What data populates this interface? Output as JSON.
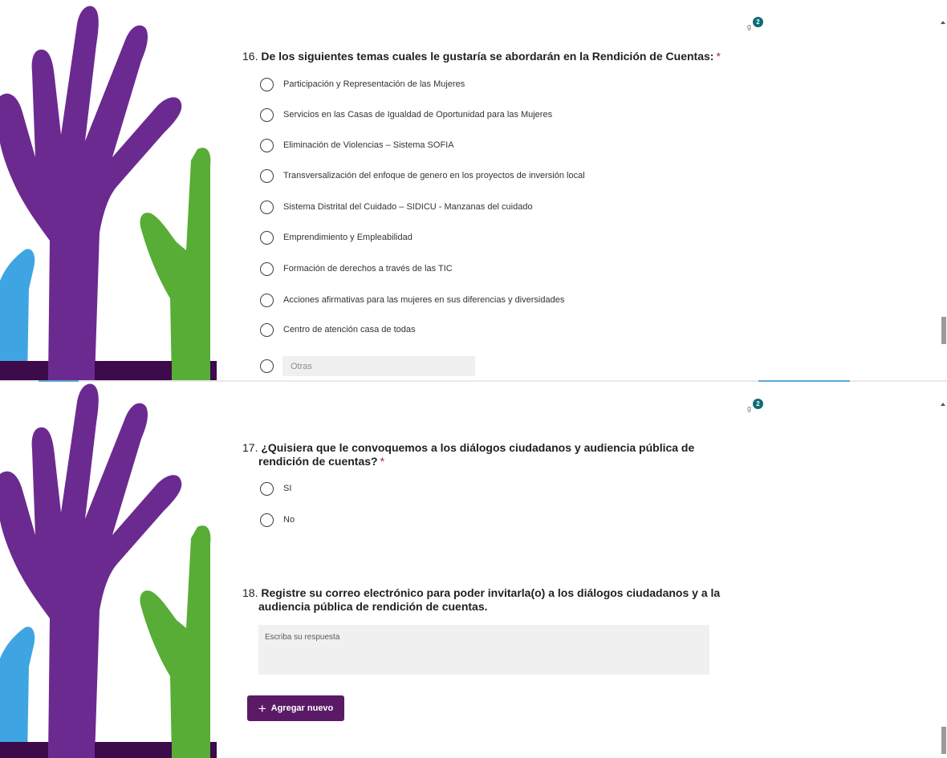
{
  "colors": {
    "purple": "#6b2a90",
    "dark_purple": "#3d0a4a",
    "green": "#57ad35",
    "blue": "#3ea5e2",
    "button": "#5b1a66",
    "required": "#b4232a",
    "badge": "#0f6b78"
  },
  "ideas_badge": {
    "icon": "lightbulb-icon",
    "count": "2"
  },
  "q16": {
    "number": "16.",
    "text": "De los siguientes temas cuales le gustaría se abordarán en la Rendición de Cuentas:",
    "required": "*",
    "options": [
      "Participación y Representación de las Mujeres",
      "Servicios en las Casas de Igualdad de Oportunidad para las Mujeres",
      "Eliminación de Violencias – Sistema SOFIA",
      "Transversalización del enfoque de genero en los proyectos de inversión local",
      " Sistema Distrital del Cuidado – SIDICU - Manzanas del cuidado",
      "Emprendimiento y Empleabilidad",
      "Formación de derechos a través de las TIC",
      "Acciones afirmativas para las mujeres en sus diferencias y diversidades",
      "Centro de atención casa de todas"
    ],
    "other_placeholder": "Otras"
  },
  "q17": {
    "number": "17.",
    "line1": "¿Quisiera que le convoquemos a los diálogos ciudadanos y audiencia pública de",
    "line2": "rendición de cuentas?",
    "required": "*",
    "options": [
      "SI",
      "No"
    ]
  },
  "q18": {
    "number": "18.",
    "line1": "Registre su correo electrónico para poder invitarla(o) a los diálogos ciudadanos y a la",
    "line2": "audiencia pública de rendición de cuentas.",
    "placeholder": "Escriba su respuesta"
  },
  "add_button": {
    "icon": "plus-icon",
    "label": "Agregar nuevo"
  }
}
